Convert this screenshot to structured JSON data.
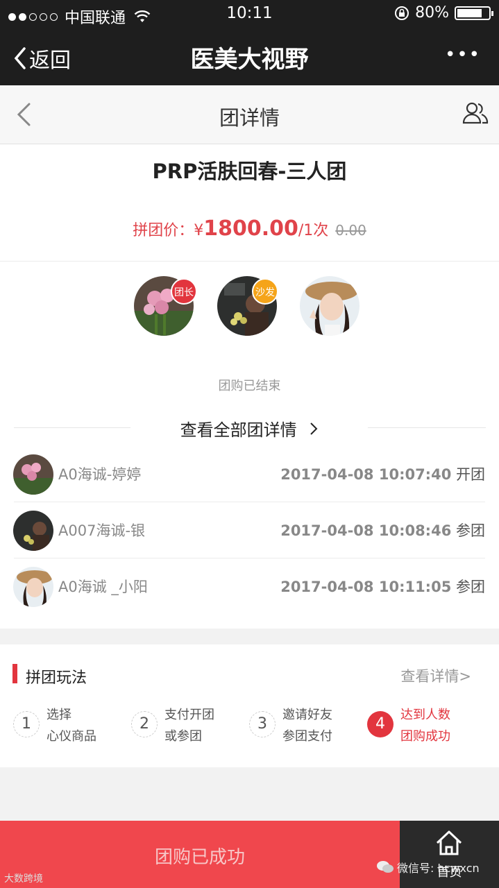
{
  "status_bar": {
    "carrier": "中国联通",
    "time": "10:11",
    "battery": "80%",
    "battery_level": 0.8
  },
  "nav": {
    "back_label": "返回",
    "title": "医美大视野",
    "more": "•••"
  },
  "page_header": {
    "title": "团详情"
  },
  "product": {
    "name": "PRP活肤回春-三人团",
    "price_label": "拼团价：",
    "currency": "¥",
    "price": "1800.00",
    "unit": "/1次",
    "original_price": "0.00"
  },
  "members": [
    {
      "badge": "团长",
      "badge_color": "#e2353e"
    },
    {
      "badge": "沙发",
      "badge_color": "#f5a41a"
    },
    {
      "badge": ""
    }
  ],
  "group_status": "团购已结束",
  "view_all_label": "查看全部团详情",
  "participants": [
    {
      "name": "A0海诚-婷婷",
      "time": "2017-04-08 10:07:40",
      "action": "开团"
    },
    {
      "name": "A007海诚-银",
      "time": "2017-04-08 10:08:46",
      "action": "参团"
    },
    {
      "name": "A0海诚 _小阳",
      "time": "2017-04-08 10:11:05",
      "action": "参团"
    }
  ],
  "rules": {
    "title": "拼团玩法",
    "more": "查看详情>",
    "steps": [
      {
        "num": "1",
        "line1": "选择",
        "line2": "心仪商品"
      },
      {
        "num": "2",
        "line1": "支付开团",
        "line2": "或参团"
      },
      {
        "num": "3",
        "line1": "邀请好友",
        "line2": "参团支付"
      },
      {
        "num": "4",
        "line1": "达到人数",
        "line2": "团购成功"
      }
    ]
  },
  "bottom": {
    "status_button": "团购已成功",
    "home_label": "首页"
  },
  "watermarks": {
    "left": "大数跨境",
    "right": "微信号: hcwxcn"
  },
  "colors": {
    "accent_red": "#e2353e",
    "bottom_red": "#f0474d",
    "badge_orange": "#f5a41a"
  }
}
